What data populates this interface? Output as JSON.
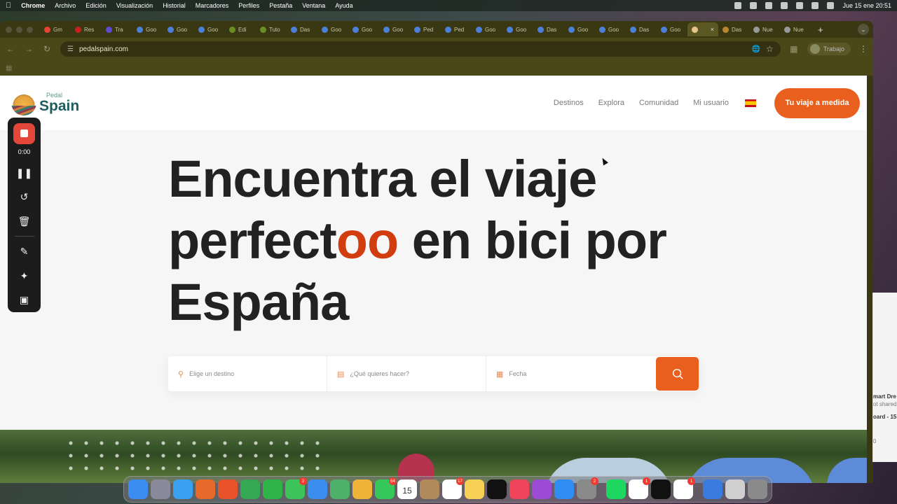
{
  "menubar": {
    "app": "Chrome",
    "items": [
      "Archivo",
      "Edición",
      "Visualización",
      "Historial",
      "Marcadores",
      "Perfiles",
      "Pestaña",
      "Ventana",
      "Ayuda"
    ],
    "clock": "Jue 15 ene 20:51"
  },
  "tabs": [
    {
      "label": "Gm",
      "color": "#ea4335"
    },
    {
      "label": "Res",
      "color": "#c5221f"
    },
    {
      "label": "Tra",
      "color": "#5b4bd6"
    },
    {
      "label": "Goo",
      "color": "#4b7fd9"
    },
    {
      "label": "Goo",
      "color": "#4b7fd9"
    },
    {
      "label": "Goo",
      "color": "#4b7fd9"
    },
    {
      "label": "Edi",
      "color": "#6b8e23"
    },
    {
      "label": "Tuto",
      "color": "#6b8e23"
    },
    {
      "label": "Das",
      "color": "#4b7fd9"
    },
    {
      "label": "Goo",
      "color": "#4b7fd9"
    },
    {
      "label": "Goo",
      "color": "#4b7fd9"
    },
    {
      "label": "Goo",
      "color": "#4b7fd9"
    },
    {
      "label": "Ped",
      "color": "#4b7fd9"
    },
    {
      "label": "Ped",
      "color": "#4b7fd9"
    },
    {
      "label": "Goo",
      "color": "#4b7fd9"
    },
    {
      "label": "Goo",
      "color": "#4b7fd9"
    },
    {
      "label": "Das",
      "color": "#4b7fd9"
    },
    {
      "label": "Goo",
      "color": "#4b7fd9"
    },
    {
      "label": "Goo",
      "color": "#4b7fd9"
    },
    {
      "label": "Das",
      "color": "#4b7fd9"
    },
    {
      "label": "Goo",
      "color": "#4b7fd9"
    },
    {
      "label": "",
      "color": "#e8c48a",
      "active": true
    },
    {
      "label": "Das",
      "color": "#b8862f"
    },
    {
      "label": "Nue",
      "color": "#999999"
    },
    {
      "label": "Nue",
      "color": "#999999"
    }
  ],
  "toolbar": {
    "url": "pedalspain.com",
    "profile": "Trabajo"
  },
  "site": {
    "logo_top": "Pedal",
    "logo_main": "Spain",
    "nav": [
      "Destinos",
      "Explora",
      "Comunidad",
      "Mi usuario"
    ],
    "cta": "Tu viaje a medida",
    "headline_a": "Encuentra el viaje",
    "headline_b": "perfect",
    "headline_accent": "oo",
    "headline_c": " en bici por",
    "headline_d": "España",
    "search": {
      "destination": "Elige un destino",
      "activity": "¿Qué quieres hacer?",
      "date": "Fecha"
    },
    "accent_color": "#e9601e"
  },
  "recorder": {
    "time": "0:00"
  },
  "peek": {
    "l1": "mart Dre",
    "l2": "ot shared",
    "l3": "oard - 15",
    "l4": "0"
  },
  "dock": {
    "apps": [
      {
        "name": "finder",
        "color": "#3b8df0"
      },
      {
        "name": "launchpad",
        "color": "#8a8a9a"
      },
      {
        "name": "safari",
        "color": "#3aa0f0"
      },
      {
        "name": "firefox",
        "color": "#e86a2a"
      },
      {
        "name": "pencil",
        "color": "#e8532a"
      },
      {
        "name": "chrome",
        "color": "#34a853"
      },
      {
        "name": "numbers",
        "color": "#2fb44a"
      },
      {
        "name": "messages",
        "color": "#3cc35a",
        "badge": "2"
      },
      {
        "name": "mail",
        "color": "#3b8df0"
      },
      {
        "name": "maps",
        "color": "#4fb06a"
      },
      {
        "name": "photos",
        "color": "#f0b43a"
      },
      {
        "name": "facetime",
        "color": "#35c759",
        "badge": "64"
      },
      {
        "name": "calendar",
        "color": "#ffffff",
        "label": "15"
      },
      {
        "name": "contacts",
        "color": "#b08a5a"
      },
      {
        "name": "reminders",
        "color": "#ffffff",
        "badge": "17"
      },
      {
        "name": "notes",
        "color": "#f7d154"
      },
      {
        "name": "tv",
        "color": "#111111"
      },
      {
        "name": "music",
        "color": "#f0445a"
      },
      {
        "name": "podcasts",
        "color": "#9b4bd6"
      },
      {
        "name": "appstore",
        "color": "#2f8cf0"
      },
      {
        "name": "settings",
        "color": "#8a8a8a",
        "badge": "2"
      },
      {
        "name": "spotify",
        "color": "#1ed760"
      },
      {
        "name": "notion",
        "color": "#ffffff",
        "badge": "1"
      },
      {
        "name": "capcut",
        "color": "#111111"
      },
      {
        "name": "slack",
        "color": "#ffffff",
        "badge": "1"
      },
      {
        "name": "browser",
        "color": "#3a7be0"
      },
      {
        "name": "keyboard",
        "color": "#cfcfcf"
      },
      {
        "name": "trash",
        "color": "#8a8a8a"
      }
    ]
  }
}
